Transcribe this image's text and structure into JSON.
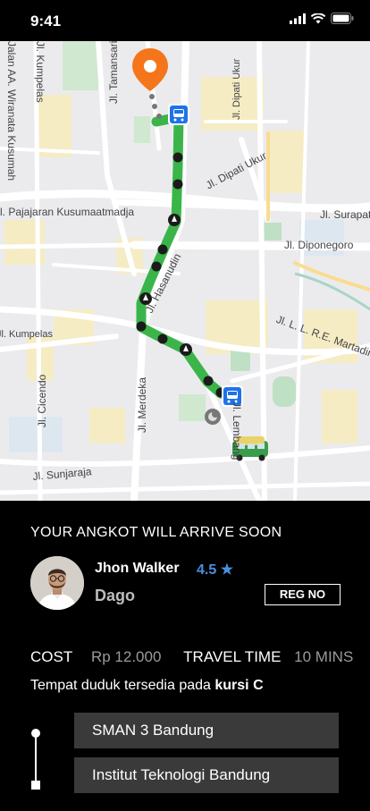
{
  "status_bar": {
    "time": "9:41"
  },
  "map": {
    "streets": [
      "Jl. Tamansari",
      "Jl. Dipati Ukur",
      "Jl. Dipati Ukur",
      "Jl. Surapati",
      "Jl. Diponegoro",
      "Jl. L. L. R.E. Martadinata",
      "Jl. Hasanudin",
      "Jl. Cicendo",
      "Jl. Merdeka",
      "Jl. Sunjaraja",
      "Jl. Lembang",
      "Jl. Kumpelas",
      "Jl. Pajajaran Kusumaatmadja",
      "Jl. Kumpelas",
      "Jalan AA. Wiranata Kusumah"
    ]
  },
  "trip": {
    "status_title": "YOUR ANGKOT WILL ARRIVE SOON",
    "driver_name": "Jhon Walker",
    "rating": "4.5 ★",
    "area": "Dago",
    "reg_button": "REG NO",
    "cost_label": "COST",
    "cost_value": "Rp 12.000",
    "travel_label": "TRAVEL TIME",
    "travel_value": "10 MINS",
    "seat_text": "Tempat duduk tersedia pada",
    "seat_value": "kursi C",
    "stops": [
      "SMAN 3 Bandung",
      "Institut Teknologi Bandung"
    ]
  },
  "colors": {
    "route": "#3bb54a",
    "pin": "#f5761a",
    "bus_stop": "#1e73e8",
    "rating": "#4a90e2"
  }
}
